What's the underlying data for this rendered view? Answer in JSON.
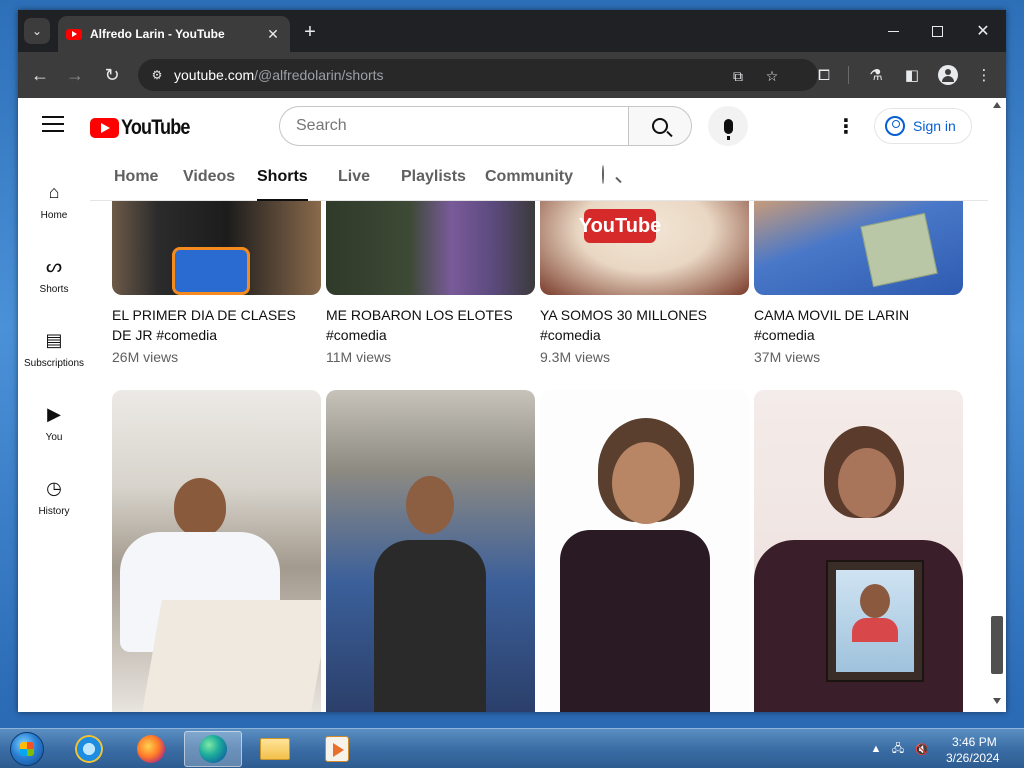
{
  "browser": {
    "tab_title": "Alfredo Larin - YouTube",
    "tab_close": "✕",
    "new_tab": "+",
    "url_host": "youtube.com",
    "url_path": "/@alfredolarin/shorts"
  },
  "youtube": {
    "logo_text": "YouTube",
    "search_placeholder": "Search",
    "signin_label": "Sign in",
    "guide": [
      {
        "label": "Home",
        "icon": "home-icon"
      },
      {
        "label": "Shorts",
        "icon": "shorts-icon"
      },
      {
        "label": "Subscriptions",
        "icon": "subscriptions-icon"
      },
      {
        "label": "You",
        "icon": "you-icon"
      },
      {
        "label": "History",
        "icon": "history-icon"
      }
    ],
    "channel_tabs": [
      "Home",
      "Videos",
      "Shorts",
      "Live",
      "Playlists",
      "Community"
    ],
    "active_tab": "Shorts",
    "shorts_row1": [
      {
        "title_line1": "EL PRIMER DIA DE CLASES",
        "title_line2": "DE JR #comedia",
        "views": "26M views"
      },
      {
        "title_line1": "ME ROBARON LOS ELOTES",
        "title_line2": "#comedia",
        "views": "11M views"
      },
      {
        "title_line1": "YA SOMOS 30 MILLONES",
        "title_line2": "#comedia",
        "views": "9.3M views"
      },
      {
        "title_line1": "CAMA MOVIL DE LARIN",
        "title_line2": "#comedia",
        "views": "37M views"
      }
    ],
    "thumb_overlay_text": "YouTube"
  },
  "taskbar": {
    "time": "3:46 PM",
    "date": "3/26/2024"
  },
  "colors": {
    "brand_red": "#ff0000",
    "link_blue": "#065fd4"
  }
}
